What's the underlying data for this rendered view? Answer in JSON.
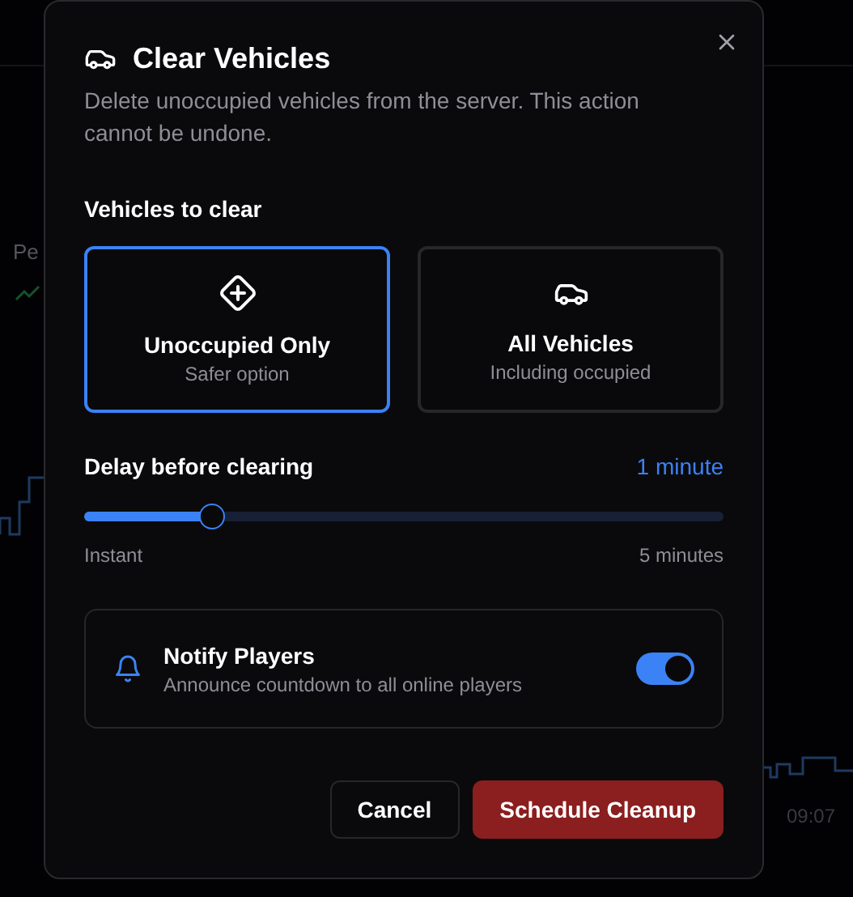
{
  "background": {
    "stat_label": "Pe",
    "time_label": "09:07"
  },
  "dialog": {
    "title": "Clear Vehicles",
    "description": "Delete unoccupied vehicles from the server. This action cannot be undone.",
    "section_label": "Vehicles to clear",
    "options": [
      {
        "kind": "unoccupied",
        "label": "Unoccupied Only",
        "sublabel": "Safer option",
        "selected": true
      },
      {
        "kind": "all",
        "label": "All Vehicles",
        "sublabel": "Including occupied",
        "selected": false
      }
    ],
    "delay": {
      "label": "Delay before clearing",
      "reading": "1 minute",
      "level": 0.2,
      "min_label": "Instant",
      "max_label": "5 minutes"
    },
    "notify": {
      "title": "Notify Players",
      "description": "Announce countdown to all online players",
      "on": true
    },
    "buttons": [
      {
        "kind": "secondary",
        "label": "Cancel"
      },
      {
        "kind": "danger",
        "label": "Schedule Cleanup"
      }
    ]
  }
}
